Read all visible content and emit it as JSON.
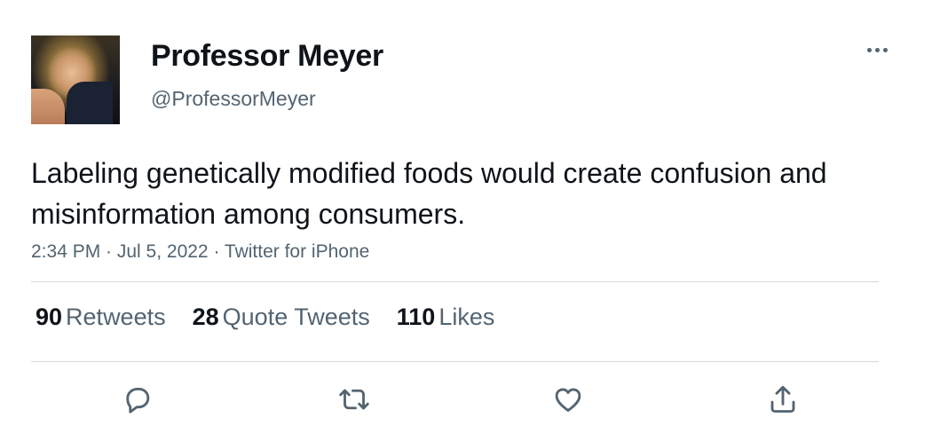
{
  "author": {
    "name": "Professor Meyer",
    "handle": "@ProfessorMeyer"
  },
  "tweet": {
    "text": "Labeling genetically modified foods would create confusion and misinformation among consumers.",
    "meta": "2:34 PM · Jul 5, 2022 · Twitter for iPhone"
  },
  "stats": {
    "retweets_count": "90",
    "retweets_label": "Retweets",
    "quotes_count": "28",
    "quotes_label": "Quote Tweets",
    "likes_count": "110",
    "likes_label": "Likes"
  },
  "icons": {
    "more": "more-horizontal-icon",
    "reply": "reply-icon",
    "retweet": "retweet-icon",
    "like": "heart-icon",
    "share": "share-icon"
  },
  "colors": {
    "text_primary": "#0f1419",
    "text_secondary": "#536471",
    "divider": "#cfd9de"
  }
}
